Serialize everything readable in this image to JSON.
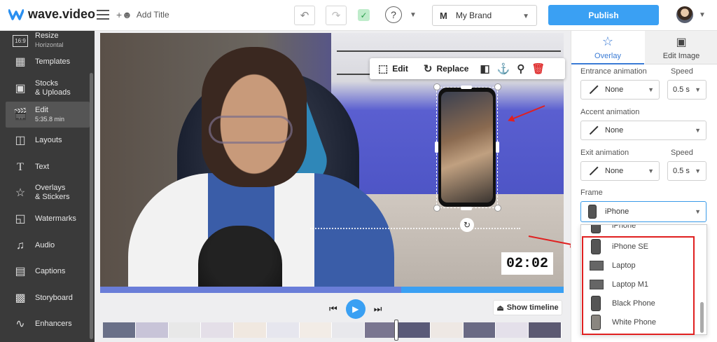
{
  "app": {
    "logo_text": "wave.video",
    "add_title_label": "Add Title"
  },
  "topbar": {
    "brand_initial": "M",
    "brand_name": "My Brand",
    "publish_label": "Publish"
  },
  "sidebar": {
    "items": [
      {
        "label": "Resize",
        "sub": "Horizontal",
        "icon": "resize-icon"
      },
      {
        "label": "Templates",
        "sub": "",
        "icon": "templates-icon"
      },
      {
        "label": "Stocks",
        "sub": "& Uploads",
        "icon": "image-icon"
      },
      {
        "label": "Edit",
        "sub": "5:35.8 min",
        "icon": "clapper-icon"
      },
      {
        "label": "Layouts",
        "sub": "",
        "icon": "layouts-icon"
      },
      {
        "label": "Text",
        "sub": "",
        "icon": "text-icon"
      },
      {
        "label": "Overlays",
        "sub": "& Stickers",
        "icon": "star-icon"
      },
      {
        "label": "Watermarks",
        "sub": "",
        "icon": "watermark-icon"
      },
      {
        "label": "Audio",
        "sub": "",
        "icon": "music-icon"
      },
      {
        "label": "Captions",
        "sub": "",
        "icon": "captions-icon"
      },
      {
        "label": "Storyboard",
        "sub": "",
        "icon": "storyboard-icon"
      },
      {
        "label": "Enhancers",
        "sub": "",
        "icon": "waveform-icon"
      }
    ],
    "resize_badge": "16:9"
  },
  "canvas": {
    "timer": "02:02",
    "progress": 0.65
  },
  "toolbar": {
    "edit_label": "Edit",
    "replace_label": "Replace"
  },
  "playback": {
    "show_timeline_label": "Show timeline"
  },
  "panel": {
    "tabs": [
      {
        "label": "Overlay",
        "icon": "star-outline-icon"
      },
      {
        "label": "Edit Image",
        "icon": "image-icon"
      }
    ],
    "entrance_label": "Entrance animation",
    "speed_label": "Speed",
    "entrance_value": "None",
    "entrance_speed": "0.5 s",
    "accent_label": "Accent animation",
    "accent_value": "None",
    "exit_label": "Exit animation",
    "exit_speed_label": "Speed",
    "exit_value": "None",
    "exit_speed": "0.5 s",
    "frame_label": "Frame",
    "frame_value": "iPhone"
  },
  "frame_dropdown": {
    "partial_item": "iPhone",
    "items": [
      "iPhone SE",
      "Laptop",
      "Laptop M1",
      "Black Phone",
      "White Phone"
    ]
  },
  "colors": {
    "accent": "#3aa0f3",
    "sidebar_bg": "#3a3a3a",
    "highlight": "#e02020"
  }
}
